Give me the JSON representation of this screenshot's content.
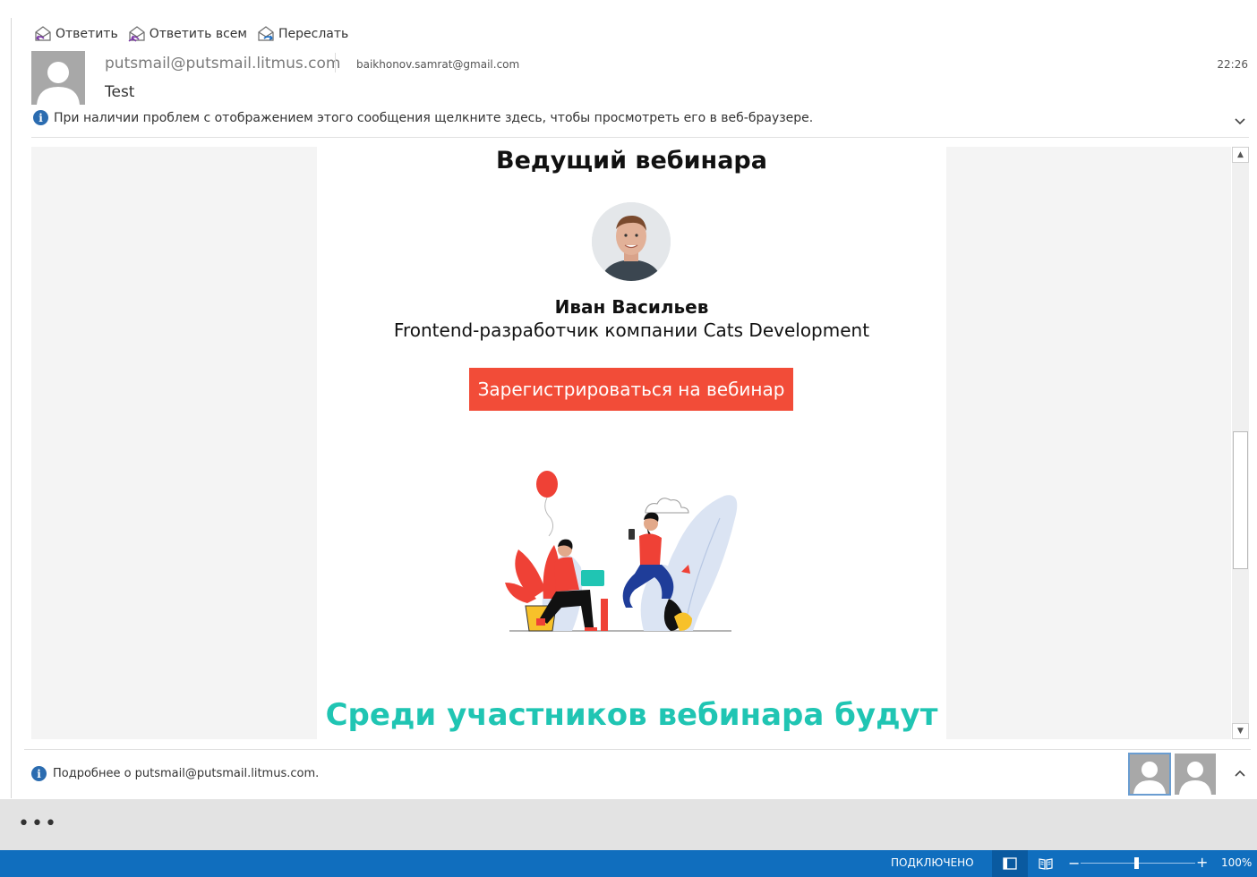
{
  "toolbar": {
    "reply": "Ответить",
    "reply_all": "Ответить всем",
    "forward": "Переслать"
  },
  "header": {
    "sender": "putsmail@putsmail.litmus.com",
    "recipient": "baikhonov.samrat@gmail.com",
    "time": "22:26",
    "subject": "Test",
    "info_message": "При наличии проблем с отображением этого сообщения щелкните здесь, чтобы просмотреть его в веб-браузере."
  },
  "email": {
    "host_heading": "Ведущий вебинара",
    "host_name": "Иван Васильев",
    "host_role": "Frontend-разработчик компании Cats Development",
    "cta_label": "Зарегистрироваться на вебинар",
    "section_heading": "Среди участников вебинара будут"
  },
  "people_pane": {
    "info": "Подробнее о putsmail@putsmail.litmus.com."
  },
  "status_bar": {
    "connection": "ПОДКЛЮЧЕНО",
    "zoom": "100%",
    "zoom_level_percent": 100
  },
  "colors": {
    "accent": "#106ebe",
    "cta": "#f24c38",
    "teal": "#20c5b3"
  },
  "icons": [
    "reply-icon",
    "reply-all-icon",
    "forward-icon",
    "info-icon",
    "chevron-down-icon",
    "chevron-up-icon",
    "more-icon",
    "normal-view-icon",
    "reading-view-icon",
    "zoom-out-icon",
    "zoom-in-icon"
  ]
}
